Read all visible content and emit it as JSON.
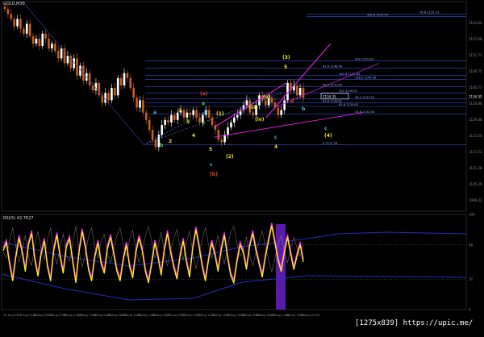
{
  "window": {
    "title": "GOLD,M30",
    "rsi_title": "RSI(5) 42.7627"
  },
  "watermark": "[1275x839] https://upic.me/",
  "colors": {
    "background": "#000000",
    "axis": "#888888",
    "price_up": "#ffffff",
    "price_down": "#c8601e",
    "level_line": "#3a4dd8",
    "magenta": "#e020e0",
    "wave_yellow": "#f0e020",
    "wave_cyan": "#40c0d0",
    "wave_green": "#40d040",
    "wave_red": "#e04020",
    "rsi_line": "#ffff00",
    "rsi_magenta": "#ff30ff",
    "rsi_highlight": "#6a1ec8"
  },
  "chart_data": [
    {
      "type": "line",
      "series": [
        {
          "values": [
            1172,
            1170,
            1168,
            1165,
            1168,
            1164,
            1162,
            1166,
            1161,
            1158,
            1160,
            1157,
            1162,
            1160,
            1156,
            1158,
            1155,
            1152,
            1156,
            1150,
            1153,
            1148,
            1152,
            1145,
            1149,
            1143,
            1146,
            1141,
            1139,
            1142,
            1137,
            1134,
            1138,
            1135,
            1140,
            1137,
            1144,
            1141,
            1146,
            1144,
            1140,
            1136,
            1132,
            1135,
            1130,
            1127,
            1123,
            1119,
            1116,
            1121,
            1125,
            1127,
            1126,
            1129,
            1127,
            1130,
            1131,
            1128,
            1130,
            1129,
            1131,
            1128,
            1126,
            1129,
            1131,
            1128,
            1125,
            1123,
            1119,
            1118,
            1121,
            1124,
            1126,
            1128,
            1129,
            1131,
            1133,
            1135,
            1130,
            1129,
            1133,
            1137,
            1135,
            1133,
            1136,
            1134,
            1132,
            1129,
            1131,
            1135,
            1142,
            1139,
            1141,
            1137,
            1140,
            1136
          ]
        }
      ],
      "y_axis_ticks": [
        "1163.64",
        "1157.68",
        "1151.73",
        "1146.75",
        "1140.77",
        "1134.80",
        "1129.48",
        "1123.20",
        "1117.22",
        "1111.28",
        "1105.29",
        "1099.22"
      ],
      "x_axis_ticks": [
        "24 Aug 2015",
        "25 Aug 01:00",
        "25 Aug 05:00",
        "25 Aug 09:00",
        "25 Aug 13:00",
        "25 Aug 17:00",
        "26 Aug 02:00",
        "26 Aug 06:00",
        "26 Aug 10:00",
        "26 Aug 14:00",
        "26 Aug 18:00",
        "27 Aug 03:00",
        "27 Aug 07:00",
        "27 Aug 11:00",
        "27 Aug 15:00",
        "27 Aug 19:00",
        "28 Aug 04:00",
        "28 Aug 08:00",
        "28 Aug 12:00",
        "28 Aug 16:00",
        "28 Aug 20:00"
      ],
      "fib_levels": [
        {
          "label": "78.6  1155.73",
          "price": 1170
        },
        {
          "label": "261.8  1155.47",
          "price": 1169
        },
        {
          "label": "200  1151.63",
          "price": 1151
        },
        {
          "label": "61.8  1148.96",
          "price": 1148
        },
        {
          "label": "161.8  1147.43",
          "price": 1145
        },
        {
          "label": "138.2  1144.39",
          "price": 1143.5
        },
        {
          "label": "50.0  1141.65",
          "price": 1140.5
        },
        {
          "label": "100  1139.92",
          "price": 1138
        },
        {
          "label": "38.2  1137.43",
          "price": 1135.5
        },
        {
          "label": "61.8  1136.61",
          "price": 1134
        },
        {
          "label": "61.8  1135.63",
          "price": 1132.5
        },
        {
          "label": "23.6  1132.48",
          "price": 1129.5
        },
        {
          "label": "0  1117.16",
          "price": 1117
        }
      ],
      "price_tag": "1134.35"
    },
    {
      "type": "line",
      "title": "RSI(5) 42.7627",
      "y_axis_ticks": [
        "100",
        "68",
        "32",
        "0"
      ],
      "ylim": [
        0,
        100
      ],
      "series": [
        {
          "values": [
            62,
            70,
            48,
            30,
            55,
            75,
            60,
            40,
            68,
            80,
            52,
            35,
            58,
            72,
            45,
            30,
            62,
            78,
            55,
            38,
            66,
            74,
            50,
            28,
            60,
            82,
            65,
            42,
            30,
            55,
            70,
            48,
            38,
            64,
            76,
            58,
            40,
            30,
            52,
            68,
            45,
            33,
            60,
            75,
            62,
            40,
            28,
            48,
            70,
            55,
            36,
            62,
            80,
            60,
            44,
            32,
            56,
            72,
            50,
            34,
            64,
            84,
            66,
            45,
            30,
            52,
            70,
            58,
            40,
            62,
            78,
            55,
            36,
            28,
            50,
            68,
            60,
            42,
            66,
            80,
            62,
            48,
            34,
            55,
            72,
            88,
            70,
            52,
            40,
            60,
            76,
            58,
            42,
            56,
            68,
            50
          ]
        }
      ]
    }
  ],
  "wave_labels": [
    {
      "text": "a",
      "color": "wave_cyan"
    },
    {
      "text": "b",
      "color": "wave_green"
    },
    {
      "text": "2",
      "color": "wave_yellow"
    },
    {
      "text": "3",
      "color": "wave_yellow"
    },
    {
      "text": "4",
      "color": "wave_yellow"
    },
    {
      "text": "a",
      "color": "wave_green"
    },
    {
      "text": "5",
      "color": "wave_yellow"
    },
    {
      "text": "(a)",
      "color": "wave_red"
    },
    {
      "text": "b",
      "color": "wave_cyan"
    },
    {
      "text": "c",
      "color": "wave_green"
    },
    {
      "text": "(1)",
      "color": "wave_yellow"
    },
    {
      "text": "5",
      "color": "wave_yellow"
    },
    {
      "text": "c",
      "color": "wave_cyan"
    },
    {
      "text": "[b]",
      "color": "wave_red"
    },
    {
      "text": "(2)",
      "color": "wave_yellow"
    },
    {
      "text": "(3)",
      "color": "wave_yellow"
    },
    {
      "text": "5",
      "color": "wave_yellow"
    },
    {
      "text": "c",
      "color": "wave_cyan"
    },
    {
      "text": "4",
      "color": "wave_yellow"
    },
    {
      "text": "b",
      "color": "wave_cyan"
    },
    {
      "text": "d",
      "color": "wave_red"
    },
    {
      "text": "c",
      "color": "wave_cyan"
    },
    {
      "text": "(4)",
      "color": "wave_yellow"
    },
    {
      "text": "(iii)",
      "color": "wave_yellow"
    },
    {
      "text": "(iv)",
      "color": "wave_yellow"
    },
    {
      "text": "(v)",
      "color": "wave_yellow"
    }
  ]
}
